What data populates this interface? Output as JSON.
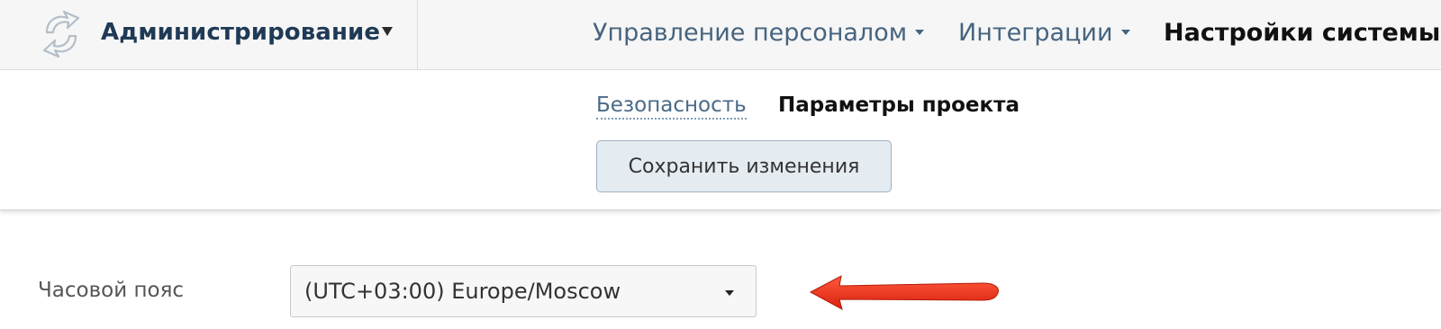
{
  "header": {
    "brand": {
      "logo_icon": "circular-arrows-logo-icon",
      "title": "Администрирование",
      "caret_icon": "caret-down-icon"
    },
    "nav": [
      {
        "label": "Управление персоналом",
        "has_dropdown": true,
        "active": false
      },
      {
        "label": "Интеграции",
        "has_dropdown": true,
        "active": false
      },
      {
        "label": "Настройки системы",
        "has_dropdown": true,
        "active": true
      }
    ]
  },
  "subnav": {
    "tabs": [
      {
        "label": "Безопасность",
        "active": false
      },
      {
        "label": "Параметры проекта",
        "active": true
      }
    ],
    "save_label": "Сохранить изменения"
  },
  "form": {
    "timezone": {
      "label": "Часовой пояс",
      "value": "(UTC+03:00) Europe/Moscow",
      "caret_icon": "caret-down-icon"
    }
  },
  "annotation": {
    "arrow_icon": "red-arrow-icon",
    "arrow_color": "#e8301c"
  },
  "colors": {
    "brand_text": "#1f3a56",
    "nav_link": "#46647f",
    "save_button_bg": "#e4ebf1"
  }
}
